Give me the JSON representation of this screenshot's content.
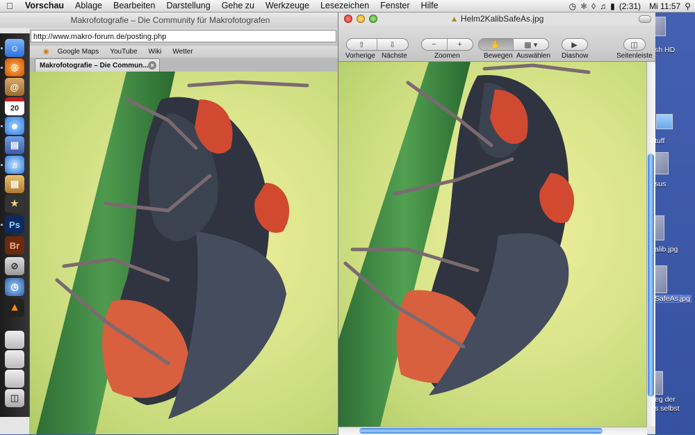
{
  "menubar": {
    "app_name": "Vorschau",
    "items": [
      "Ablage",
      "Bearbeiten",
      "Darstellung",
      "Gehe zu",
      "Werkzeuge",
      "Lesezeichen",
      "Fenster",
      "Hilfe"
    ],
    "battery": "(2:31)",
    "clock": "Mi 11:57"
  },
  "browser": {
    "window_title": "Makrofotografie – Die Community für Makrofotografen",
    "url": "http://www.makro-forum.de/posting.php",
    "bookmarks": [
      "Google Maps",
      "YouTube",
      "Wiki",
      "Wetter"
    ],
    "tab_label": "Makrofotografie – Die Commun..."
  },
  "preview": {
    "file_name": "Helm2KalibSafeAs.jpg",
    "toolbar": {
      "prev_label": "Vorherige",
      "next_label": "Nächste",
      "zoom_label": "Zoomen",
      "move_label": "Bewegen",
      "select_label": "Auswählen",
      "slideshow_label": "Diashow",
      "sidebar_label": "Seitenleiste"
    }
  },
  "dock": {
    "ps_label": "Ps",
    "br_label": "Br",
    "cal_day": "20"
  },
  "desktop": {
    "items": [
      "sh HD",
      "tuff",
      "sus",
      "alib.jpg",
      "SafeAs.jpg",
      "eg der",
      "s selbst"
    ]
  }
}
